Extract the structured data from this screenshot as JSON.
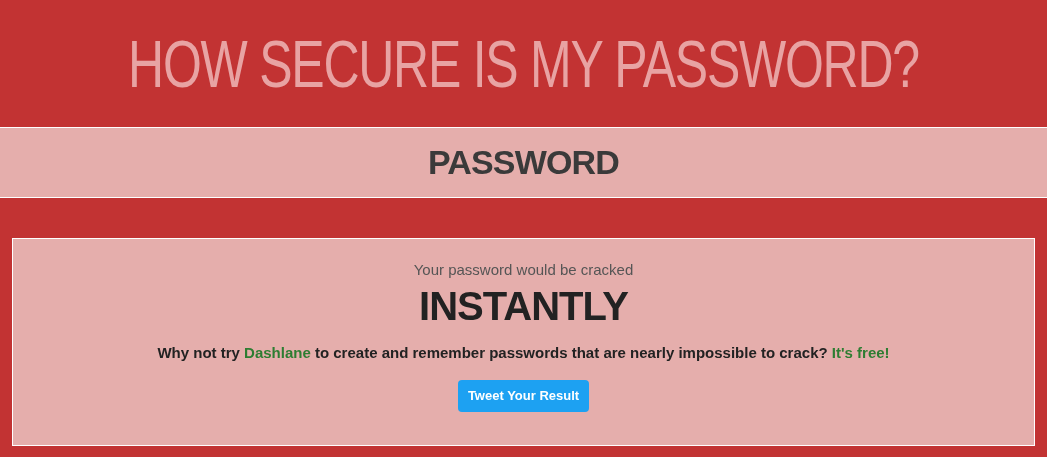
{
  "header": {
    "title": "HOW SECURE IS MY PASSWORD?"
  },
  "password_field": {
    "placeholder": "PASSWORD"
  },
  "result": {
    "intro": "Your password would be cracked",
    "time": "INSTANTLY",
    "message": {
      "before": "Why not try ",
      "link": "Dashlane",
      "middle": " to create and remember passwords that are nearly impossible to crack? ",
      "end_link": "It's free!"
    },
    "button": "Tweet Your Result"
  }
}
